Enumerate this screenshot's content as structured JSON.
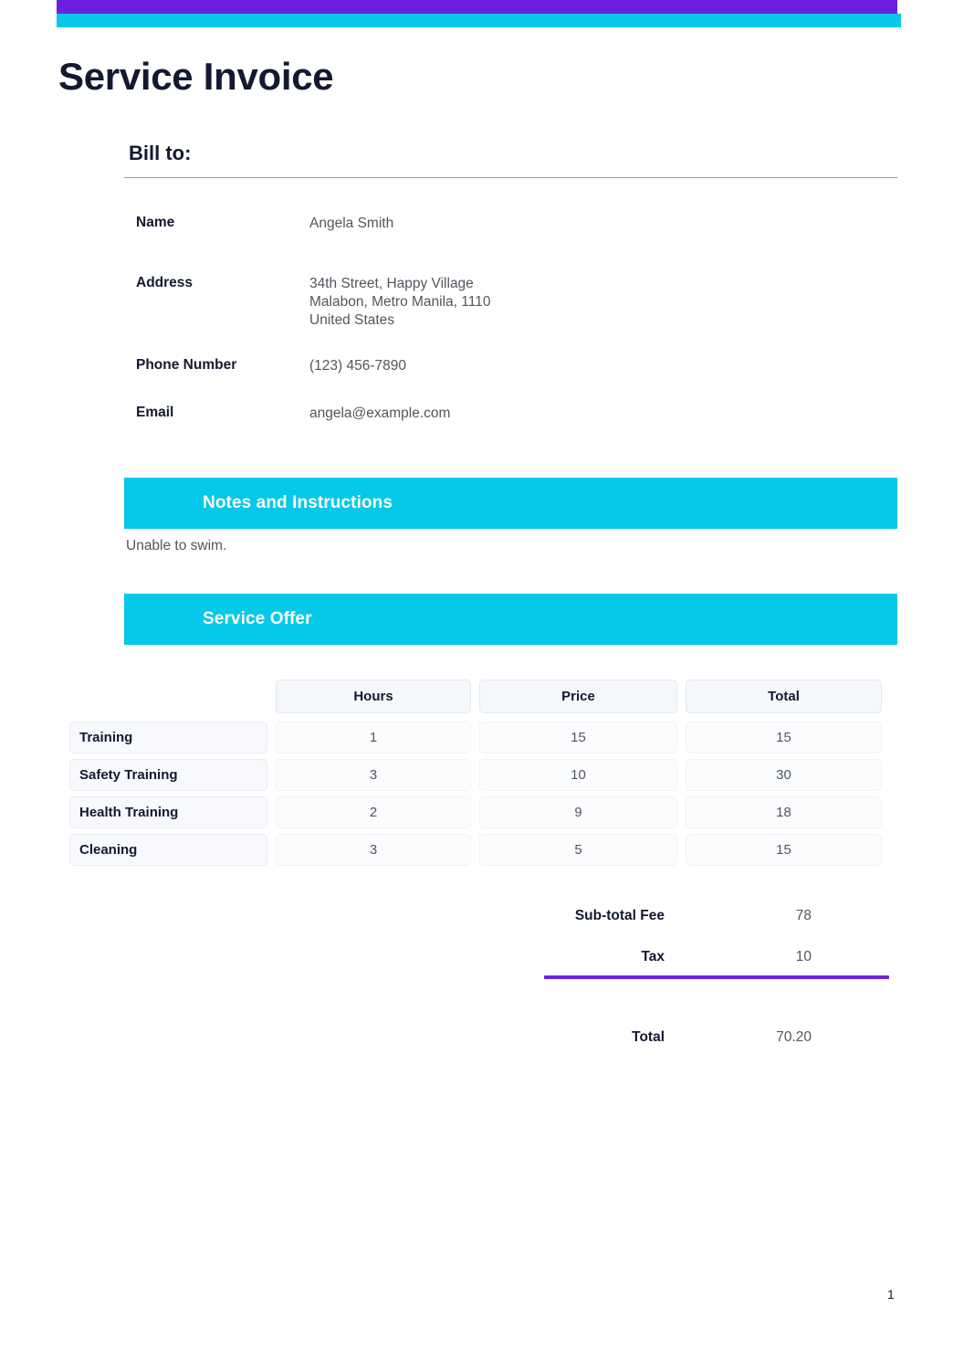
{
  "document": {
    "title": "Service Invoice",
    "page_number": "1"
  },
  "colors": {
    "accent_purple": "#6C1FE0",
    "accent_cyan": "#06C8E8",
    "heading_text": "#141931",
    "body_text": "#53565f",
    "divider_purple": "#6B23E0"
  },
  "bill_to": {
    "heading": "Bill to:",
    "fields": [
      {
        "label": "Name",
        "value": "Angela Smith"
      },
      {
        "label": "Address",
        "value": "34th Street, Happy Village\nMalabon, Metro Manila, 1110\nUnited States"
      },
      {
        "label": "Phone Number",
        "value": "(123) 456-7890"
      },
      {
        "label": "Email",
        "value": "angela@example.com"
      }
    ]
  },
  "notes": {
    "banner_title": "Notes and Instructions",
    "body": "Unable to swim."
  },
  "service_offer": {
    "banner_title": "Service Offer",
    "columns": [
      "",
      "Hours",
      "Price",
      "Total"
    ],
    "rows": [
      {
        "item": "Training",
        "hours": "1",
        "price": "15",
        "total": "15"
      },
      {
        "item": "Safety Training",
        "hours": "3",
        "price": "10",
        "total": "30"
      },
      {
        "item": "Health Training",
        "hours": "2",
        "price": "9",
        "total": "18"
      },
      {
        "item": "Cleaning",
        "hours": "3",
        "price": "5",
        "total": "15"
      }
    ]
  },
  "totals": {
    "subtotal_label": "Sub-total Fee",
    "subtotal_value": "78",
    "tax_label": "Tax",
    "tax_value": "10",
    "total_label": "Total",
    "total_value": "70.20"
  }
}
